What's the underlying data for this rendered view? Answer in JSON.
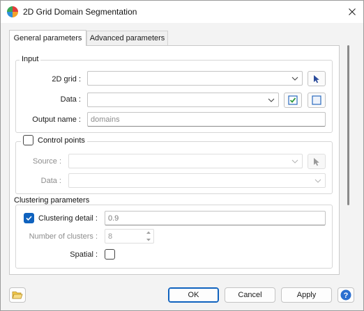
{
  "window": {
    "title": "2D Grid Domain Segmentation",
    "app_icon": "palette-app-icon",
    "close_icon": "close-icon"
  },
  "tabs": [
    {
      "label": "General parameters",
      "active": true
    },
    {
      "label": "Advanced parameters",
      "active": false
    }
  ],
  "input_group": {
    "title": "Input",
    "grid_label": "2D grid :",
    "grid_value": "",
    "data_label": "Data :",
    "data_value": "",
    "output_label": "Output name :",
    "output_placeholder": "domains"
  },
  "control_points": {
    "title": "Control points",
    "checked": false,
    "source_label": "Source :",
    "source_value": "",
    "data_label": "Data :",
    "data_value": ""
  },
  "clustering": {
    "title": "Clustering parameters",
    "detail_label": "Clustering detail :",
    "detail_checked": true,
    "detail_value": "0.9",
    "clusters_label": "Number of clusters :",
    "clusters_value": "8",
    "spatial_label": "Spatial :",
    "spatial_checked": false
  },
  "footer": {
    "ok_label": "OK",
    "cancel_label": "Cancel",
    "apply_label": "Apply"
  },
  "colors": {
    "accent": "#0f62be",
    "check_green": "#2e9a3e"
  }
}
